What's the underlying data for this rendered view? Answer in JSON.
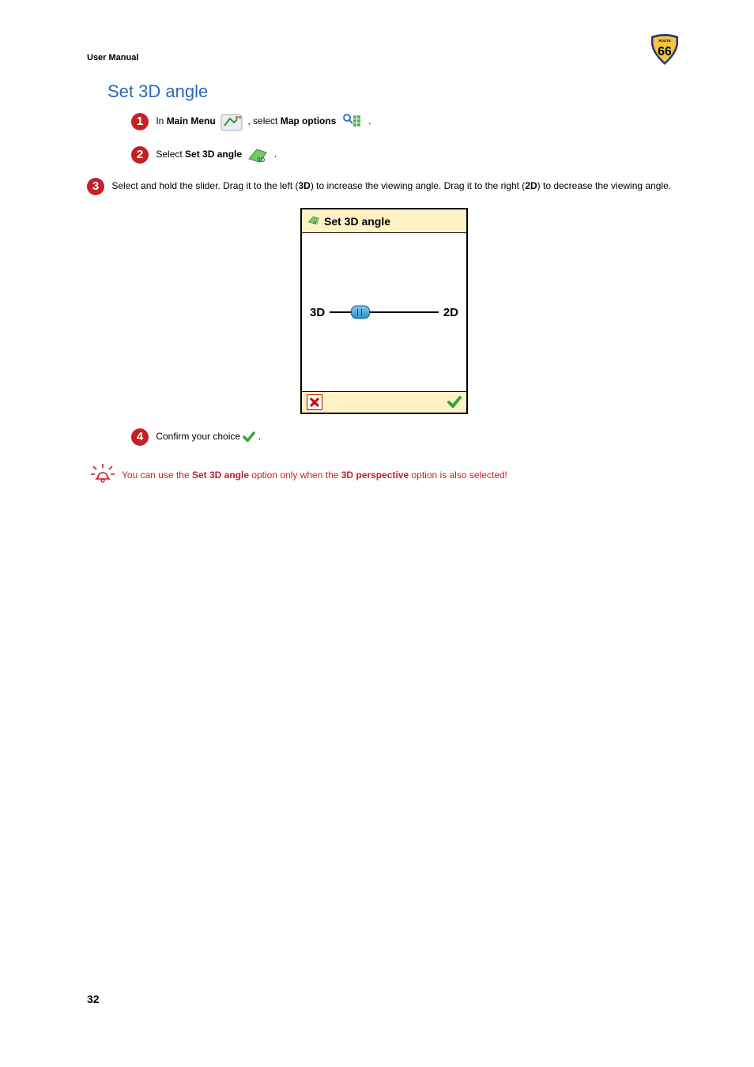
{
  "header": {
    "left": "User Manual"
  },
  "title": "Set 3D angle",
  "steps": {
    "s1a": "In ",
    "s1b": "Main Menu",
    "s1c": " , select ",
    "s1d": "Map options",
    "s1e": " .",
    "s2a": "Select ",
    "s2b": "Set 3D angle",
    "s2c": " .",
    "s3a": "Select and hold the slider. Drag it to the left (",
    "s3b": "3D",
    "s3c": ") to increase the viewing angle. Drag it to the right (",
    "s3d": "2D",
    "s3e": ") to decrease the viewing angle.",
    "s4a": "Confirm your choice ",
    "s4b": "."
  },
  "figure": {
    "title": "Set 3D angle",
    "left": "3D",
    "right": "2D"
  },
  "note": {
    "a": "You can use the ",
    "b": "Set 3D angle",
    "c": " option only when the ",
    "d": "3D perspective",
    "e": " option is also selected!"
  },
  "page_number": "32"
}
